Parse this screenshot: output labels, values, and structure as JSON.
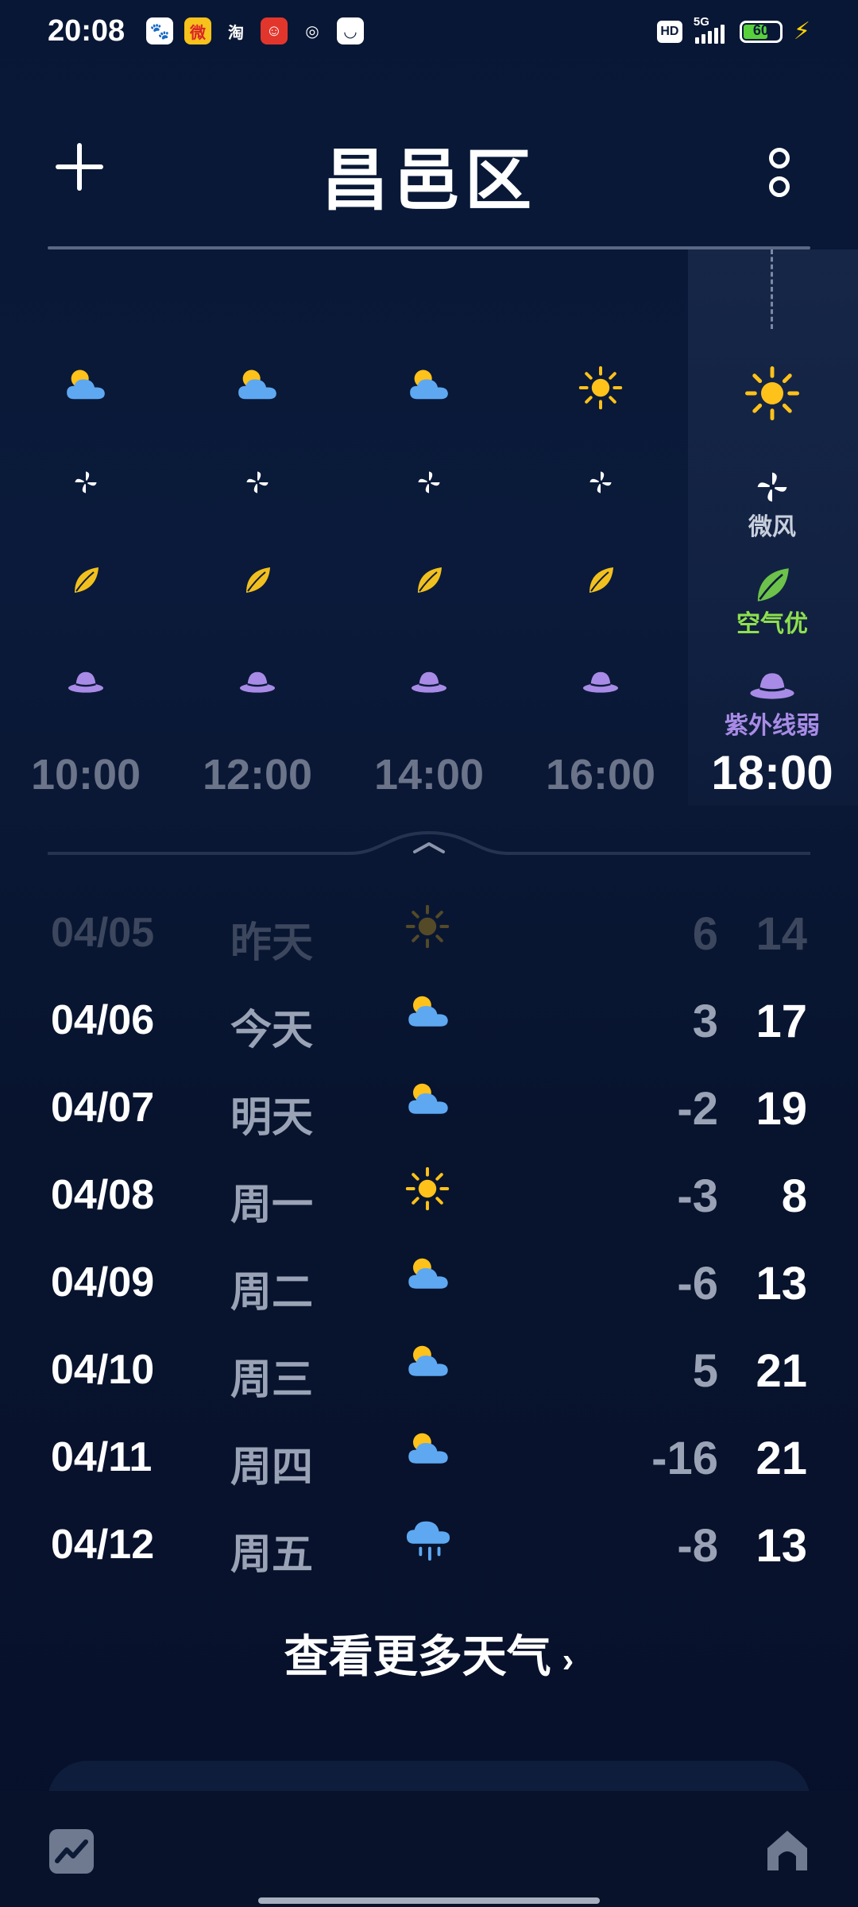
{
  "status_bar": {
    "time": "20:08",
    "apps": [
      {
        "name": "baidu-icon",
        "glyph": "🐾",
        "bg": "#ffffff",
        "fg": "#2f5fe0"
      },
      {
        "name": "weibo-icon",
        "glyph": "微",
        "bg": "#f6c21b",
        "fg": "#d9242a"
      },
      {
        "name": "taobao-icon",
        "glyph": "淘",
        "bg": "transparent",
        "fg": "#ffffff"
      },
      {
        "name": "app-red-icon",
        "glyph": "☺",
        "bg": "#e2362c",
        "fg": "#ffffff"
      },
      {
        "name": "orbit-app-icon",
        "glyph": "◎",
        "bg": "transparent",
        "fg": "#ffffff"
      },
      {
        "name": "shopping-bag-icon",
        "glyph": "◡",
        "bg": "#ffffff",
        "fg": "#0b1a3a"
      }
    ],
    "hd": "HD",
    "network": "5G",
    "battery": "60"
  },
  "header": {
    "city": "昌邑区"
  },
  "hourly": [
    {
      "time": "10:00",
      "weather": "partly-cloudy",
      "current": false
    },
    {
      "time": "12:00",
      "weather": "partly-cloudy",
      "current": false
    },
    {
      "time": "14:00",
      "weather": "partly-cloudy",
      "current": false
    },
    {
      "time": "16:00",
      "weather": "sunny",
      "current": false
    },
    {
      "time": "18:00",
      "weather": "sunny",
      "current": true,
      "wind": "微风",
      "air": "空气优",
      "uv": "紫外线弱"
    }
  ],
  "daily": [
    {
      "date": "04/05",
      "day": "昨天",
      "weather": "sunny",
      "low": "6",
      "high": "14",
      "past": true
    },
    {
      "date": "04/06",
      "day": "今天",
      "weather": "partly-cloudy",
      "low": "3",
      "high": "17",
      "past": false
    },
    {
      "date": "04/07",
      "day": "明天",
      "weather": "partly-cloudy",
      "low": "-2",
      "high": "19",
      "past": false
    },
    {
      "date": "04/08",
      "day": "周一",
      "weather": "sunny",
      "low": "-3",
      "high": "8",
      "past": false
    },
    {
      "date": "04/09",
      "day": "周二",
      "weather": "partly-cloudy",
      "low": "-6",
      "high": "13",
      "past": false
    },
    {
      "date": "04/10",
      "day": "周三",
      "weather": "partly-cloudy",
      "low": "5",
      "high": "21",
      "past": false
    },
    {
      "date": "04/11",
      "day": "周四",
      "weather": "partly-cloudy",
      "low": "-16",
      "high": "21",
      "past": false
    },
    {
      "date": "04/12",
      "day": "周五",
      "weather": "rain",
      "low": "-8",
      "high": "13",
      "past": false
    }
  ],
  "more_weather": {
    "label": "查看更多天气",
    "chevron": "›"
  },
  "colors": {
    "accent_sun": "#ffc21a",
    "cloud": "#5ea8f2",
    "air_good": "#8ee04e",
    "uv": "#a88be6"
  }
}
